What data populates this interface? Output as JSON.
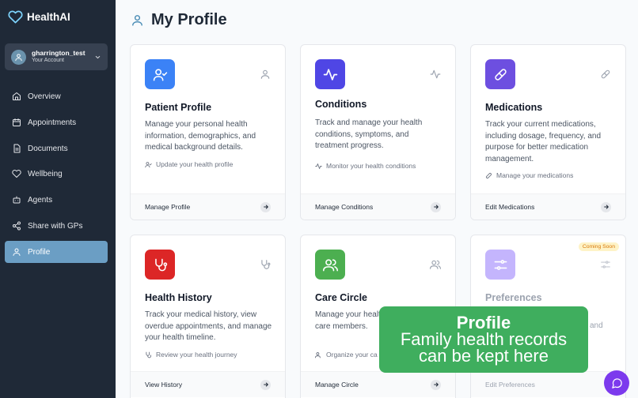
{
  "app": {
    "name": "HealthAI"
  },
  "account": {
    "username": "gharrington_test",
    "subtitle": "Your Account"
  },
  "sidebar": {
    "items": [
      {
        "label": "Overview",
        "icon": "home-icon"
      },
      {
        "label": "Appointments",
        "icon": "calendar-icon"
      },
      {
        "label": "Documents",
        "icon": "document-icon"
      },
      {
        "label": "Wellbeing",
        "icon": "heart-icon"
      },
      {
        "label": "Agents",
        "icon": "bot-icon"
      },
      {
        "label": "Share with GPs",
        "icon": "share-icon"
      },
      {
        "label": "Profile",
        "icon": "user-icon",
        "active": true
      }
    ]
  },
  "page": {
    "title": "My Profile"
  },
  "cards": [
    {
      "title": "Patient Profile",
      "description": "Manage your personal health information, demographics, and medical background details.",
      "hint": "Update your health profile",
      "action": "Manage Profile",
      "icon": "user-check-icon",
      "color": "#3b82f6"
    },
    {
      "title": "Conditions",
      "description": "Track and manage your health conditions, symptoms, and treatment progress.",
      "hint": "Monitor your health conditions",
      "action": "Manage Conditions",
      "icon": "activity-icon",
      "color": "#4f46e5"
    },
    {
      "title": "Medications",
      "description": "Track your current medications, including dosage, frequency, and purpose for better medication management.",
      "hint": "Manage your medications",
      "action": "Edit Medications",
      "icon": "pill-icon",
      "color": "#6d4fe0"
    },
    {
      "title": "Health History",
      "description": "Track your medical history, view overdue appointments, and manage your health timeline.",
      "hint": "Review your health journey",
      "action": "View History",
      "icon": "stethoscope-icon",
      "color": "#dc2626"
    },
    {
      "title": "Care Circle",
      "description": "Manage your health specialists, and care members.",
      "hint": "Organize your ca",
      "action": "Manage Circle",
      "icon": "users-icon",
      "color": "#4caf50"
    },
    {
      "title": "Preferences",
      "description": "and",
      "action": "Edit Preferences",
      "icon": "sliders-icon",
      "color": "#c4b5fd",
      "badge": "Coming Soon"
    }
  ],
  "overlay": {
    "title": "Profile",
    "line1": "Family health records",
    "line2": "can be kept here"
  }
}
